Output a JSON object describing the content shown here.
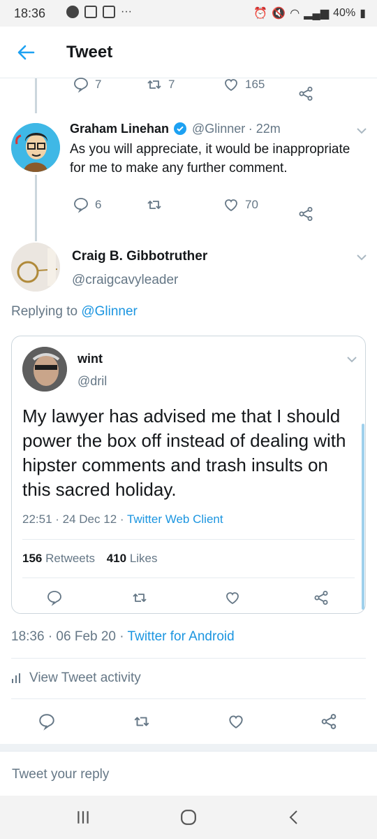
{
  "status_bar": {
    "time": "18:36",
    "battery": "40%"
  },
  "header": {
    "title": "Tweet"
  },
  "tweet_prev": {
    "replies": "7",
    "retweets": "7",
    "likes": "165"
  },
  "tweet_graham": {
    "name": "Graham Linehan",
    "handle": "@Glinner",
    "time": "· 22m",
    "text": "As you will appreciate, it would be inappropriate for me to make any further comment.",
    "replies": "6",
    "retweets": "",
    "likes": "70"
  },
  "tweet_main": {
    "name": "Craig B. Gibbotruther",
    "handle": "@craigcavyleader",
    "replying_prefix": "Replying to",
    "replying_to": "@Glinner",
    "timestamp": "18:36 · 06 Feb 20 ·",
    "client": "Twitter for Android",
    "activity": "View Tweet activity",
    "reply_placeholder": "Tweet your reply"
  },
  "quoted": {
    "name": "wint",
    "handle": "@dril",
    "text": "My lawyer has advised me that I should  power the box off instead of dealing with hipster comments and trash insults on this sacred holiday.",
    "timestamp": "22:51 · 24 Dec 12 ·",
    "client": "Twitter Web Client",
    "retweets_count": "156",
    "retweets_label": "Retweets",
    "likes_count": "410",
    "likes_label": "Likes"
  },
  "colors": {
    "accent": "#1da1f2",
    "link": "#1b95e0",
    "muted": "#657786"
  }
}
